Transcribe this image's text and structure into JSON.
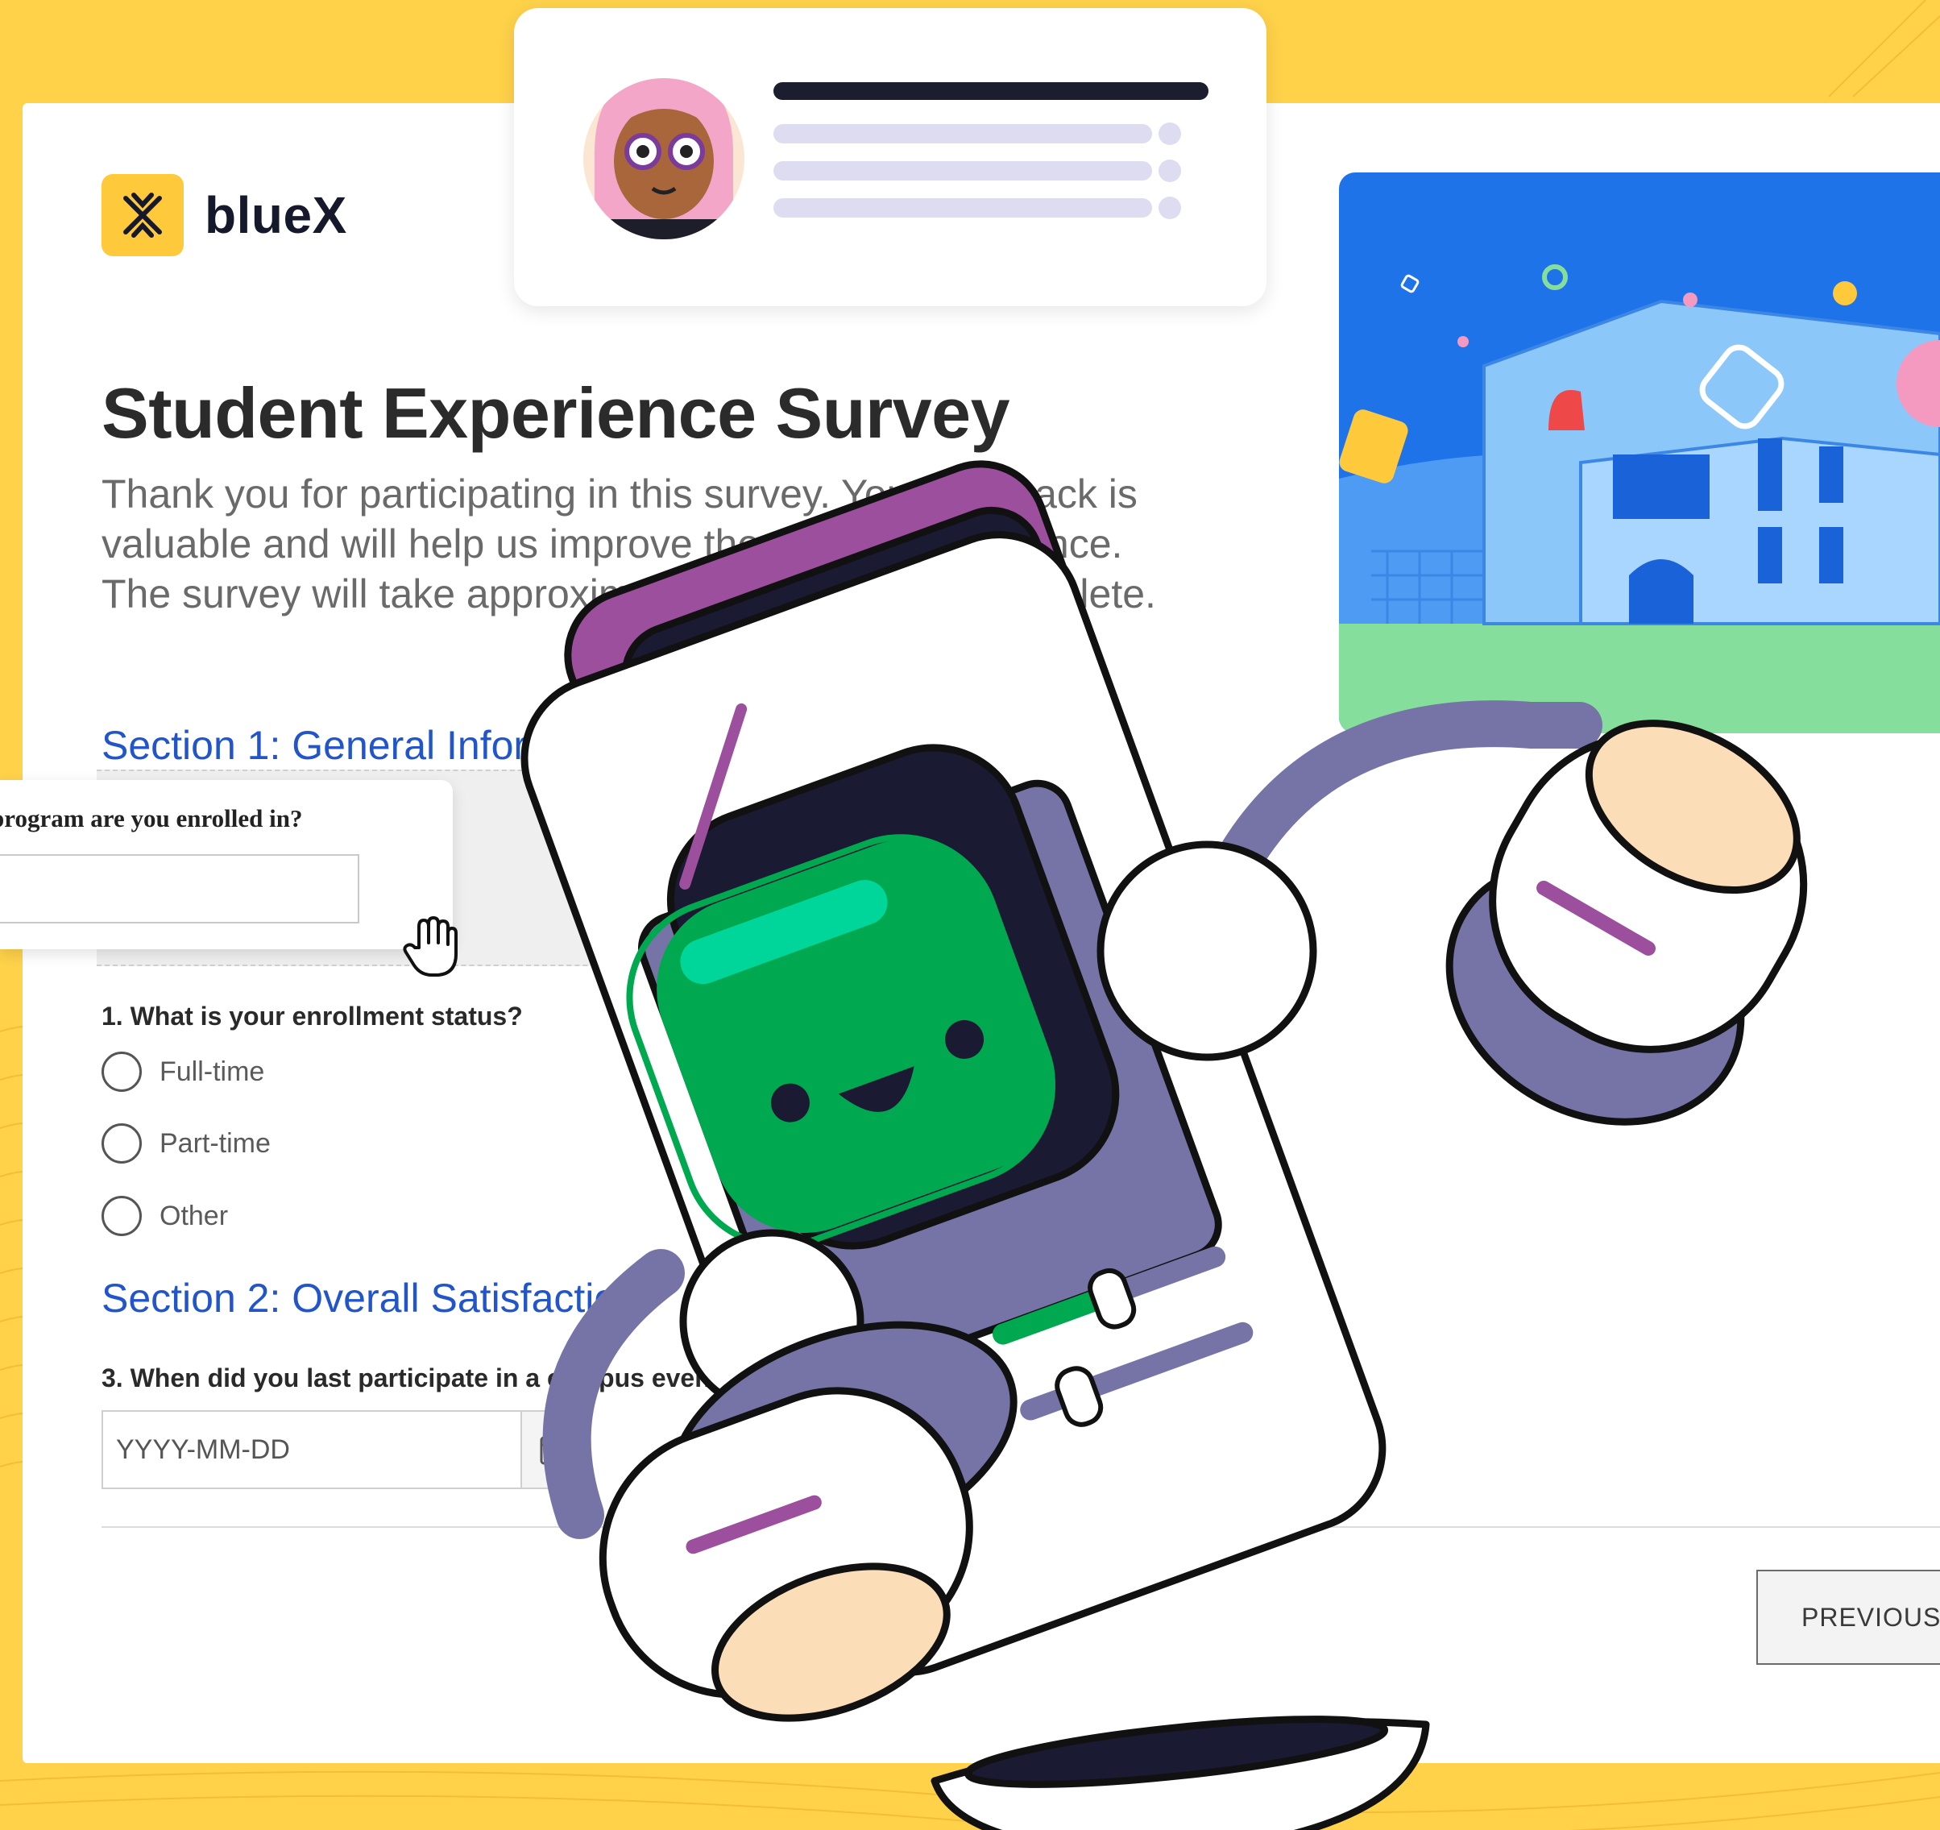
{
  "brand": {
    "name": "blueX"
  },
  "survey": {
    "title": "Student Experience Survey",
    "intro_line1": "Thank you for participating in this survey. Your feedback is",
    "intro_line2": "valuable and will help us improve the student experience.",
    "intro_line3": "The survey will take approximately 10 minutes to complete."
  },
  "section1": {
    "title": "Section 1: General Information",
    "dragged_question": "program are you enrolled in?",
    "question1": "1. What is your enrollment status?",
    "options": [
      "Full-time",
      "Part-time",
      "Other"
    ]
  },
  "section2": {
    "title": "Section 2: Overall Satisfaction",
    "question3": "3. When did you last participate in a campus event?",
    "date_placeholder": "YYYY-MM-DD"
  },
  "nav": {
    "previous_label": "PREVIOUS"
  },
  "colors": {
    "background": "#FFD24A",
    "accent": "#2155c9",
    "robot_purple": "#9B4F9C",
    "robot_green": "#00A84F"
  },
  "icons": [
    "logo-x-icon",
    "hand-cursor-icon",
    "calendar-icon"
  ]
}
